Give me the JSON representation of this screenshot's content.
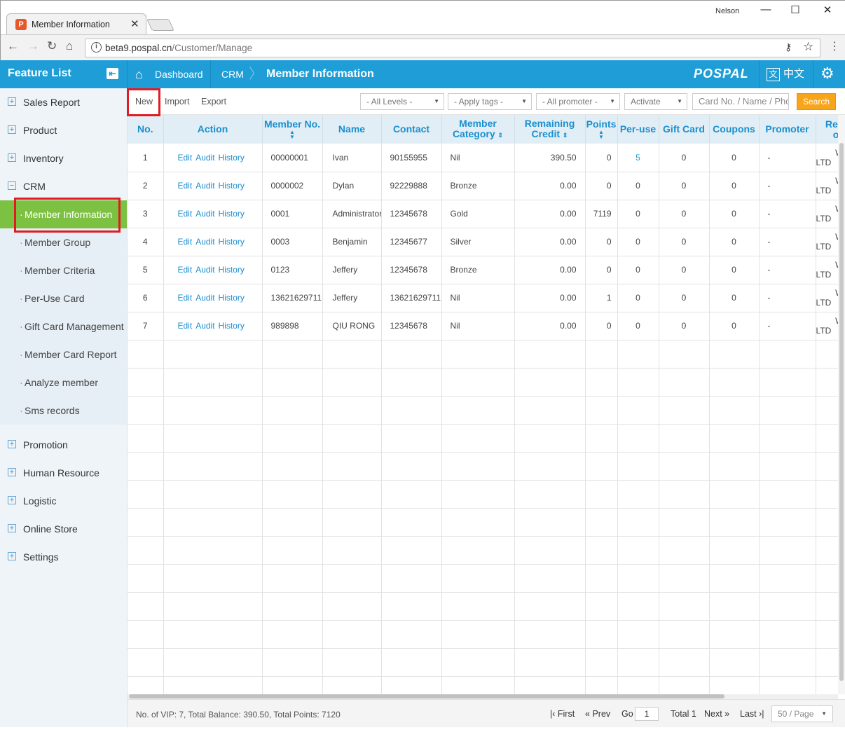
{
  "browser": {
    "tab_title": "Member Information",
    "tab_favicon": "pospal-favicon",
    "user": "Nelson",
    "url_host": "beta9.pospal.cn",
    "url_path": "/Customer/Manage"
  },
  "appbar": {
    "feature_list": "Feature List",
    "breadcrumbs": [
      "Dashboard",
      "CRM",
      "Member Information"
    ],
    "logo": "POSPAL",
    "language": "中文",
    "language_icon": "文"
  },
  "sidebar": {
    "items": [
      {
        "label": "Sales Report",
        "icon": "+"
      },
      {
        "label": "Product",
        "icon": "+"
      },
      {
        "label": "Inventory",
        "icon": "+"
      },
      {
        "label": "CRM",
        "icon": "−"
      }
    ],
    "crm_sub": [
      "Member Information",
      "Member Group",
      "Member Criteria",
      "Per-Use Card",
      "Gift Card Management",
      "Member Card Report",
      "Analyze member",
      "Sms records"
    ],
    "items_after": [
      {
        "label": "Promotion",
        "icon": "+"
      },
      {
        "label": "Human Resource",
        "icon": "+"
      },
      {
        "label": "Logistic",
        "icon": "+"
      },
      {
        "label": "Online Store",
        "icon": "+"
      },
      {
        "label": "Settings",
        "icon": "+"
      }
    ]
  },
  "filters": {
    "new": "New",
    "import": "Import",
    "export": "Export",
    "levels": "- All Levels -",
    "tags": "- Apply tags -",
    "promoter": "- All promoter -",
    "activate": "Activate",
    "search_placeholder": "Card No. / Name / Phone",
    "search_button": "Search"
  },
  "table": {
    "headers": {
      "no": "No.",
      "action": "Action",
      "member_no": "Member No.",
      "name": "Name",
      "contact": "Contact",
      "category_1": "Member",
      "category_2": "Category",
      "credit_1": "Remaining",
      "credit_2": "Credit",
      "points": "Points",
      "peruse": "Per-use",
      "giftcard": "Gift Card",
      "coupons": "Coupons",
      "promoter": "Promoter",
      "region_1": "Regi",
      "region_2": "o"
    },
    "actions": {
      "edit": "Edit",
      "audit": "Audit",
      "history": "History"
    },
    "rows": [
      {
        "no": "1",
        "member_no": "00000001",
        "name": "Ivan",
        "contact": "90155955",
        "category": "Nil",
        "credit": "390.50",
        "points": "0",
        "peruse": "5",
        "giftcard": "0",
        "coupons": "0",
        "promoter": "-",
        "region_1": "WEE",
        "region_2": "LTD"
      },
      {
        "no": "2",
        "member_no": "0000002",
        "name": "Dylan",
        "contact": "92229888",
        "category": "Bronze",
        "credit": "0.00",
        "points": "0",
        "peruse": "0",
        "giftcard": "0",
        "coupons": "0",
        "promoter": "-",
        "region_1": "WEE",
        "region_2": "LTD"
      },
      {
        "no": "3",
        "member_no": "0001",
        "name": "Administrator",
        "contact": "12345678",
        "category": "Gold",
        "credit": "0.00",
        "points": "7119",
        "peruse": "0",
        "giftcard": "0",
        "coupons": "0",
        "promoter": "-",
        "region_1": "WEE",
        "region_2": "LTD"
      },
      {
        "no": "4",
        "member_no": "0003",
        "name": "Benjamin",
        "contact": "12345677",
        "category": "Silver",
        "credit": "0.00",
        "points": "0",
        "peruse": "0",
        "giftcard": "0",
        "coupons": "0",
        "promoter": "-",
        "region_1": "WEE",
        "region_2": "LTD"
      },
      {
        "no": "5",
        "member_no": "0123",
        "name": "Jeffery",
        "contact": "12345678",
        "category": "Bronze",
        "credit": "0.00",
        "points": "0",
        "peruse": "0",
        "giftcard": "0",
        "coupons": "0",
        "promoter": "-",
        "region_1": "WEE",
        "region_2": "LTD"
      },
      {
        "no": "6",
        "member_no": "13621629711",
        "name": "Jeffery",
        "contact": "13621629711",
        "category": "Nil",
        "credit": "0.00",
        "points": "1",
        "peruse": "0",
        "giftcard": "0",
        "coupons": "0",
        "promoter": "-",
        "region_1": "WEE",
        "region_2": "LTD"
      },
      {
        "no": "7",
        "member_no": "989898",
        "name": "QIU RONG",
        "contact": "12345678",
        "category": "Nil",
        "credit": "0.00",
        "points": "0",
        "peruse": "0",
        "giftcard": "0",
        "coupons": "0",
        "promoter": "-",
        "region_1": "WEE",
        "region_2": "LTD"
      }
    ],
    "empty_rows": 13
  },
  "footer": {
    "summary": "No. of VIP: 7, Total Balance: 390.50, Total Points: 7120",
    "first": "First",
    "prev": "Prev",
    "go": "Go",
    "page": "1",
    "total": "Total 1",
    "next": "Next",
    "last": "Last",
    "per_page": "50 / Page"
  },
  "colors": {
    "accent": "#1e9dd6",
    "active_menu": "#7cc142",
    "search_button": "#f8a51a",
    "highlight_box": "#e11b22"
  }
}
